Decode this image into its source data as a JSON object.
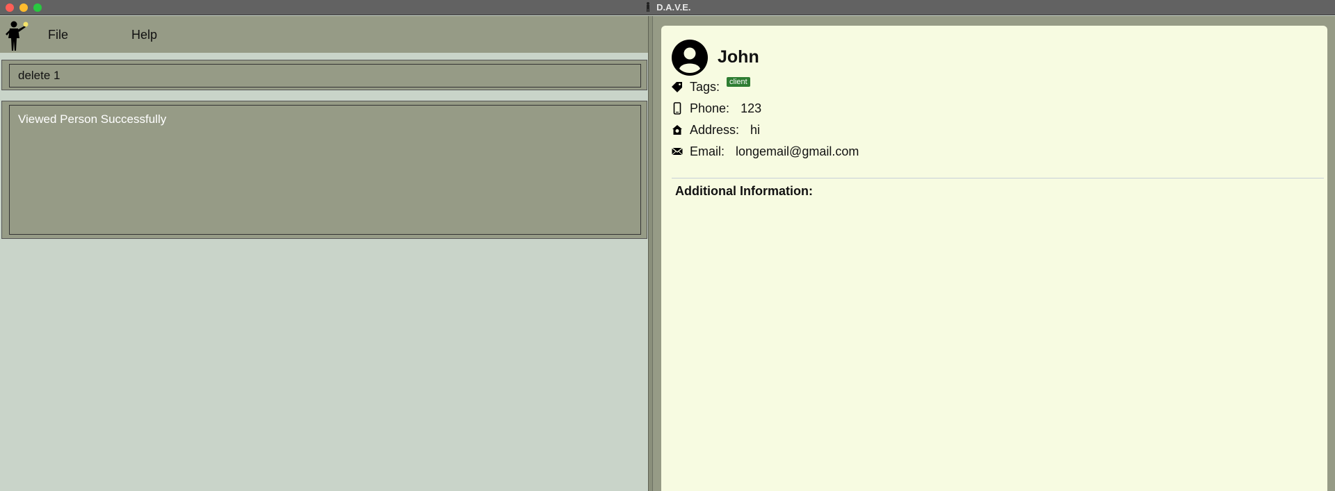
{
  "window": {
    "title": "D.A.V.E."
  },
  "menu": {
    "file": "File",
    "help": "Help"
  },
  "command": {
    "value": "delete 1"
  },
  "result": {
    "message": "Viewed Person Successfully"
  },
  "person": {
    "name": "John",
    "tags_label": "Tags:",
    "tags": [
      "client"
    ],
    "phone_label": "Phone:",
    "phone": "123",
    "address_label": "Address:",
    "address": "hi",
    "email_label": "Email:",
    "email": "longemail@gmail.com",
    "additional_label": "Additional Information:"
  },
  "colors": {
    "tag_bg": "#2e7d32",
    "panel": "#969b86",
    "card": "#f7fbe1"
  },
  "icons": [
    "person-silhouette-icon",
    "avatar-icon",
    "tag-icon",
    "phone-icon",
    "home-icon",
    "mail-icon"
  ]
}
